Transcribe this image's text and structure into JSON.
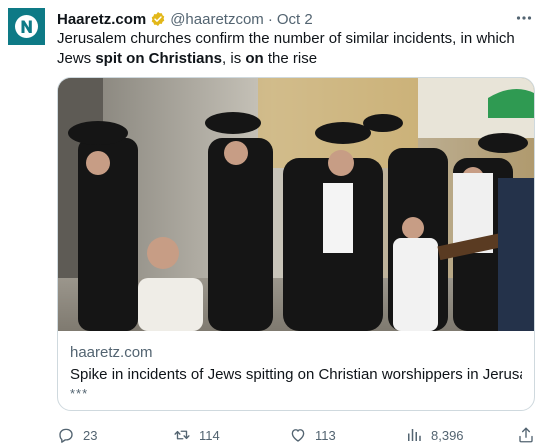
{
  "author": {
    "name": "Haaretz.com",
    "handle": "@haaretzcom",
    "separator": "·",
    "date": "Oct 2",
    "avatar_icon": "haaretz-logo-icon",
    "verified_icon": "gold-verified-badge-icon"
  },
  "tweet": {
    "part1": "Jerusalem churches confirm the number of similar incidents, in which Jews ",
    "bold1": "spit on Christians",
    "part2": ", is ",
    "bold2": "on",
    "part3": " the rise"
  },
  "card": {
    "domain": "haaretz.com",
    "title": "Spike in incidents of Jews spitting on Christian worshippers in Jerusal...",
    "description": "***"
  },
  "actions": {
    "replies": "23",
    "reposts": "114",
    "likes": "113",
    "views": "8,396"
  },
  "colors": {
    "avatar_bg": "#0e7a86",
    "verified_gold": "#e2b719",
    "text_secondary": "#536471",
    "border": "#cfd9de"
  }
}
